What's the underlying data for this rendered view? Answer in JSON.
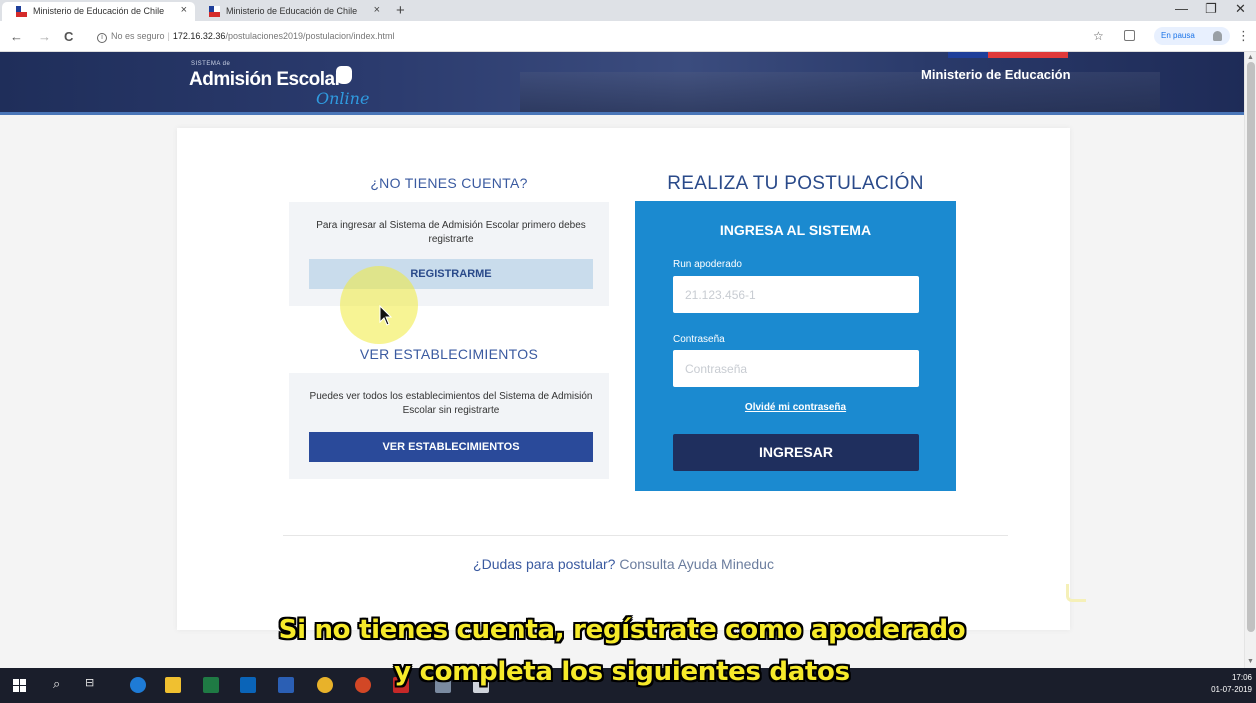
{
  "browser": {
    "tabs": [
      {
        "title": "Ministerio de Educación de Chile",
        "active": true
      },
      {
        "title": "Ministerio de Educación de Chile",
        "active": false
      }
    ],
    "new_tab": "+",
    "tab_close": "×",
    "minimize": "—",
    "restore": "❐",
    "close": "✕",
    "back": "←",
    "forward": "→",
    "reload": "C",
    "security_label": "No es seguro",
    "url_host": "172.16.32.36",
    "url_path": "/postulaciones2019/postulacion/index.html",
    "paused_label": "En pausa",
    "menu": "⋮",
    "star": "☆"
  },
  "header": {
    "logo_small": "SISTEMA de",
    "logo_main": "Admisión Escolar",
    "logo_online": "Online",
    "ministry": "Ministerio de Educación",
    "flag_colors": [
      "#1f3f9a",
      "#e03a3a"
    ]
  },
  "left": {
    "no_account_title": "¿NO TIENES CUENTA?",
    "no_account_text": "Para ingresar al Sistema de Admisión Escolar primero debes registrarte",
    "register_button": "REGISTRARME",
    "view_title": "VER ESTABLECIMIENTOS",
    "view_text": "Puedes ver todos los establecimientos del Sistema de Admisión Escolar sin registrarte",
    "view_button": "VER ESTABLECIMIENTOS"
  },
  "login": {
    "title": "REALIZA TU POSTULACIÓN",
    "box_title": "INGRESA AL SISTEMA",
    "run_label": "Run apoderado",
    "run_placeholder": "21.123.456-1",
    "password_label": "Contraseña",
    "password_placeholder": "Contraseña",
    "forgot": "Olvidé mi contraseña",
    "submit": "INGRESAR"
  },
  "help": {
    "question": "¿Dudas para postular?",
    "link": "Consulta Ayuda Mineduc"
  },
  "subtitles": {
    "line1": "Si no tienes cuenta, regístrate como apoderado",
    "line2": "y completa los siguientes datos"
  },
  "taskbar": {
    "time": "17:06",
    "date": "01-07-2019"
  },
  "colors": {
    "accent_blue": "#1b8ad0",
    "dark_navy": "#1f2f5e",
    "button_blue": "#2a4a9a",
    "subtitle_yellow": "#f6ea2a"
  }
}
